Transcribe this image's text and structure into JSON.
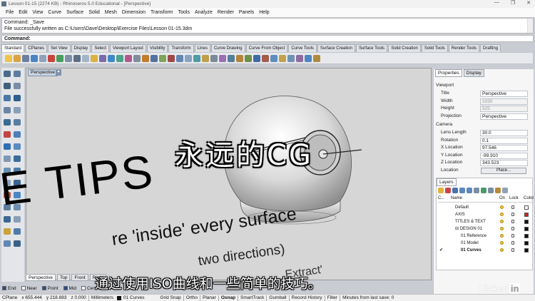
{
  "window": {
    "title": "Lesson 01-15 (2274 KB) - Rhinoceros 5.0 Educational - [Perspective]",
    "controls": [
      "—",
      "❐",
      "✕"
    ]
  },
  "menu": [
    "File",
    "Edit",
    "View",
    "Curve",
    "Surface",
    "Solid",
    "Mesh",
    "Dimension",
    "Transform",
    "Tools",
    "Analyze",
    "Render",
    "Panels",
    "Help"
  ],
  "command_history": [
    "Command: _Save",
    "File successfully written as C:\\Users\\Dave\\Desktop\\Exercise Files\\Lesson 01-15.3dm"
  ],
  "command_prompt": "Command:",
  "toolbar_tabs": [
    "Standard",
    "CPlanes",
    "Set View",
    "Display",
    "Select",
    "Viewport Layout",
    "Visibility",
    "Transform",
    "Lines",
    "Curve Drawing",
    "Curve From Object",
    "Curve Tools",
    "Surface Creation",
    "Surface Tools",
    "Solid Creation",
    "Solid Tools",
    "Render Tools",
    "Drafting"
  ],
  "toolbar_active_tab": "Standard",
  "viewport": {
    "label": "Perspective",
    "tabs": [
      "Perspective",
      "Top",
      "Front",
      "Right"
    ],
    "active_tab": "Perspective",
    "overlay_lines": [
      "E TIPS",
      "re 'inside' every surface",
      "two directions)",
      "Extract'"
    ],
    "subtitle_top": "永远的CG",
    "subtitle_bottom": "通过使用ISO曲线和一些简单的技巧。"
  },
  "osnap": [
    "End",
    "Near",
    "Point",
    "Mid",
    "Cen"
  ],
  "osnap_checked": [
    true,
    false,
    true,
    true,
    false
  ],
  "status_bar": {
    "cplane": "CPlane",
    "x": "x 655.444",
    "y": "y 218.883",
    "z": "z 0.000",
    "units": "Millimeters",
    "layer": "01 Curves",
    "toggles": [
      "Grid Snap",
      "Ortho",
      "Planar",
      "Osnap",
      "SmartTrack",
      "Gumball",
      "Record History",
      "Filter"
    ],
    "message": "Minutes from last save: 0"
  },
  "properties_panel": {
    "tabs": [
      "Properties",
      "Display"
    ],
    "active_tab": "Properties",
    "section_viewport": "Viewport",
    "viewport_rows": [
      {
        "k": "Title",
        "v": "Perspective",
        "dim": false
      },
      {
        "k": "Width",
        "v": "1030",
        "dim": true
      },
      {
        "k": "Height",
        "v": "525",
        "dim": true
      },
      {
        "k": "Projection",
        "v": "Perspective",
        "dim": false
      }
    ],
    "section_camera": "Camera",
    "camera_rows": [
      {
        "k": "Lens Length",
        "v": "30.0",
        "dim": false
      },
      {
        "k": "Rotation",
        "v": "0.1",
        "dim": false
      },
      {
        "k": "X Location",
        "v": "97.546",
        "dim": false
      },
      {
        "k": "Y Location",
        "v": "-99.910",
        "dim": false
      },
      {
        "k": "Z Location",
        "v": "343.523",
        "dim": false
      },
      {
        "k": "Location",
        "v": "",
        "dim": false
      }
    ],
    "place_button": "Place..."
  },
  "layers_panel": {
    "title": "Layers",
    "headers": [
      "C...",
      "Name",
      "On",
      "Lock",
      "Color"
    ],
    "rows": [
      {
        "name": "Default",
        "indent": 0,
        "on": true,
        "color": "#ffffff",
        "current": false
      },
      {
        "name": "AXIS",
        "indent": 0,
        "on": true,
        "color": "#d62020",
        "current": false
      },
      {
        "name": "TITLES & TEXT",
        "indent": 0,
        "on": true,
        "color": "#111111",
        "current": false
      },
      {
        "name": "⊟ DESIGN 01",
        "indent": 0,
        "on": true,
        "color": "#111111",
        "current": false
      },
      {
        "name": "01 Reference",
        "indent": 1,
        "on": true,
        "color": "#111111",
        "current": false
      },
      {
        "name": "01 Model",
        "indent": 1,
        "on": true,
        "color": "#111111",
        "current": false
      },
      {
        "name": "01 Curves",
        "indent": 1,
        "on": true,
        "color": "#111111",
        "current": true
      }
    ],
    "current_mark": "✔"
  },
  "watermark": "Linked",
  "watermark_in": "in"
}
